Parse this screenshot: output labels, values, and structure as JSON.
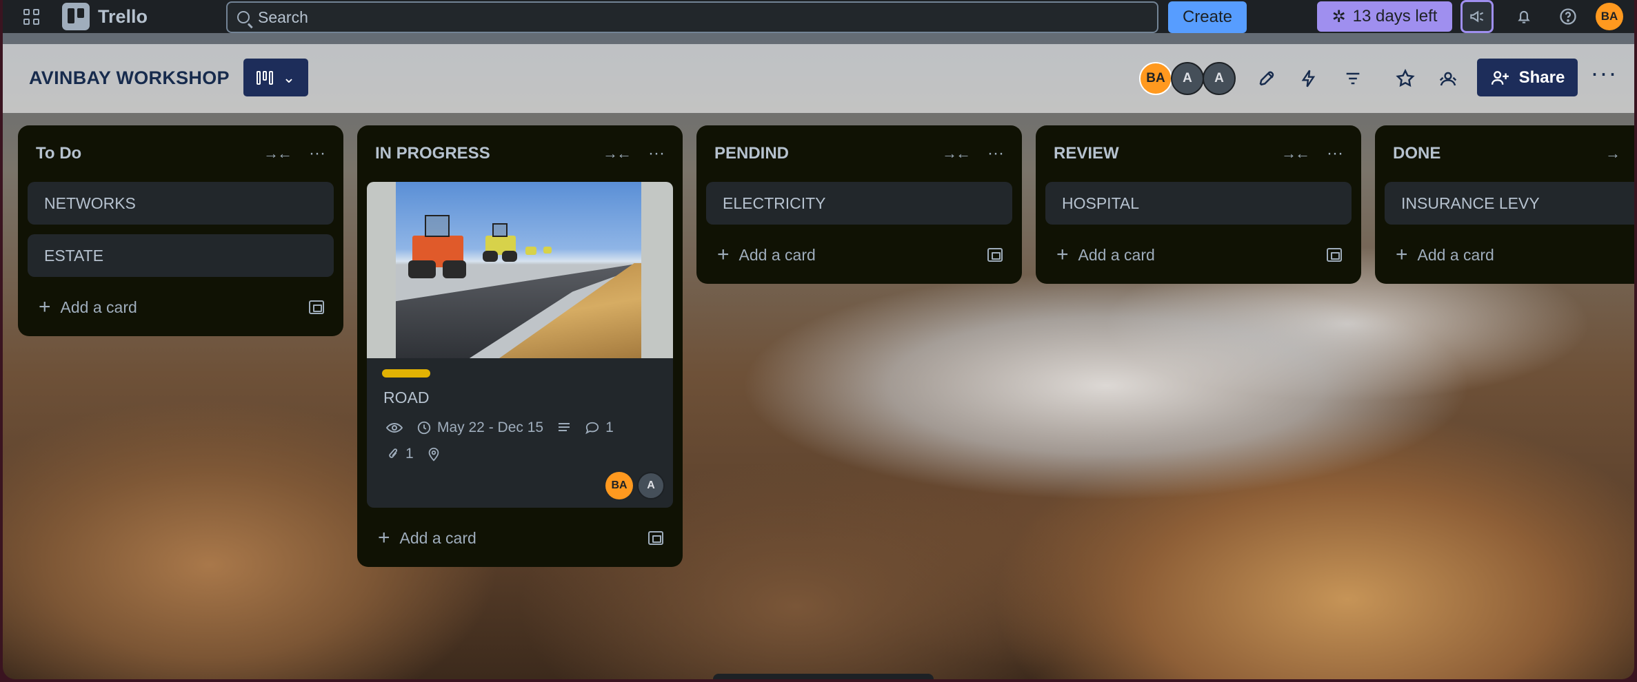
{
  "nav": {
    "app_name": "Trello",
    "search_placeholder": "Search",
    "create_label": "Create",
    "trial_label": "13 days left",
    "user_initials": "BA"
  },
  "board": {
    "title": "AVINBAY WORKSHOP",
    "members": [
      "BA",
      "A",
      "A"
    ],
    "share_label": "Share"
  },
  "lists": [
    {
      "title": "To Do",
      "cards": [
        "NETWORKS",
        "ESTATE"
      ],
      "add_label": "Add a card"
    },
    {
      "title": "IN PROGRESS",
      "rich_card": {
        "title": "ROAD",
        "label_color": "#e2b203",
        "dates": "May 22 - Dec 15",
        "comments": "1",
        "attachments": "1",
        "members": [
          "BA",
          "A"
        ]
      },
      "add_label": "Add a card"
    },
    {
      "title": "PENDIND",
      "cards": [
        "ELECTRICITY"
      ],
      "add_label": "Add a card"
    },
    {
      "title": "REVIEW",
      "cards": [
        "HOSPITAL"
      ],
      "add_label": "Add a card"
    },
    {
      "title": "DONE",
      "cards": [
        "INSURANCE LEVY"
      ],
      "add_label": "Add a card"
    }
  ],
  "colors": {
    "nav_bg": "#1d2125",
    "list_bg": "#101204",
    "card_bg": "#22272b",
    "create_btn": "#579dff",
    "trial_btn": "#9f8fef",
    "share_btn": "#1d2d5a",
    "avatar_ba": "#ff991f"
  }
}
